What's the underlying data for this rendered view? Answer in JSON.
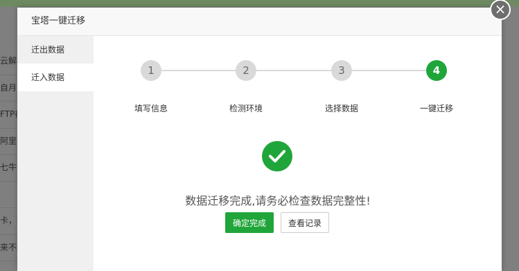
{
  "background": {
    "rows": [
      "云解析",
      "自月免",
      "FTP存",
      "阿里云",
      "七牛对",
      "",
      "卡，通",
      "来不好"
    ]
  },
  "dialog": {
    "title": "宝塔一键迁移",
    "close_symbol": "×",
    "sidebar": {
      "items": [
        {
          "label": "迁出数据",
          "active": false
        },
        {
          "label": "迁入数据",
          "active": true
        }
      ]
    },
    "steps": [
      {
        "number": "1",
        "label": "填写信息",
        "status": "inactive"
      },
      {
        "number": "2",
        "label": "检测环境",
        "status": "inactive"
      },
      {
        "number": "3",
        "label": "选择数据",
        "status": "inactive"
      },
      {
        "number": "4",
        "label": "一键迁移",
        "status": "active"
      }
    ],
    "success": {
      "icon": "check-circle-icon",
      "message": "数据迁移完成,请务必检查数据完整性!"
    },
    "buttons": {
      "confirm": "确定完成",
      "view_log": "查看记录"
    }
  },
  "colors": {
    "accent": "#20a53a",
    "step_inactive": "#d9d9d9",
    "overlay": "#7f7f7f"
  }
}
